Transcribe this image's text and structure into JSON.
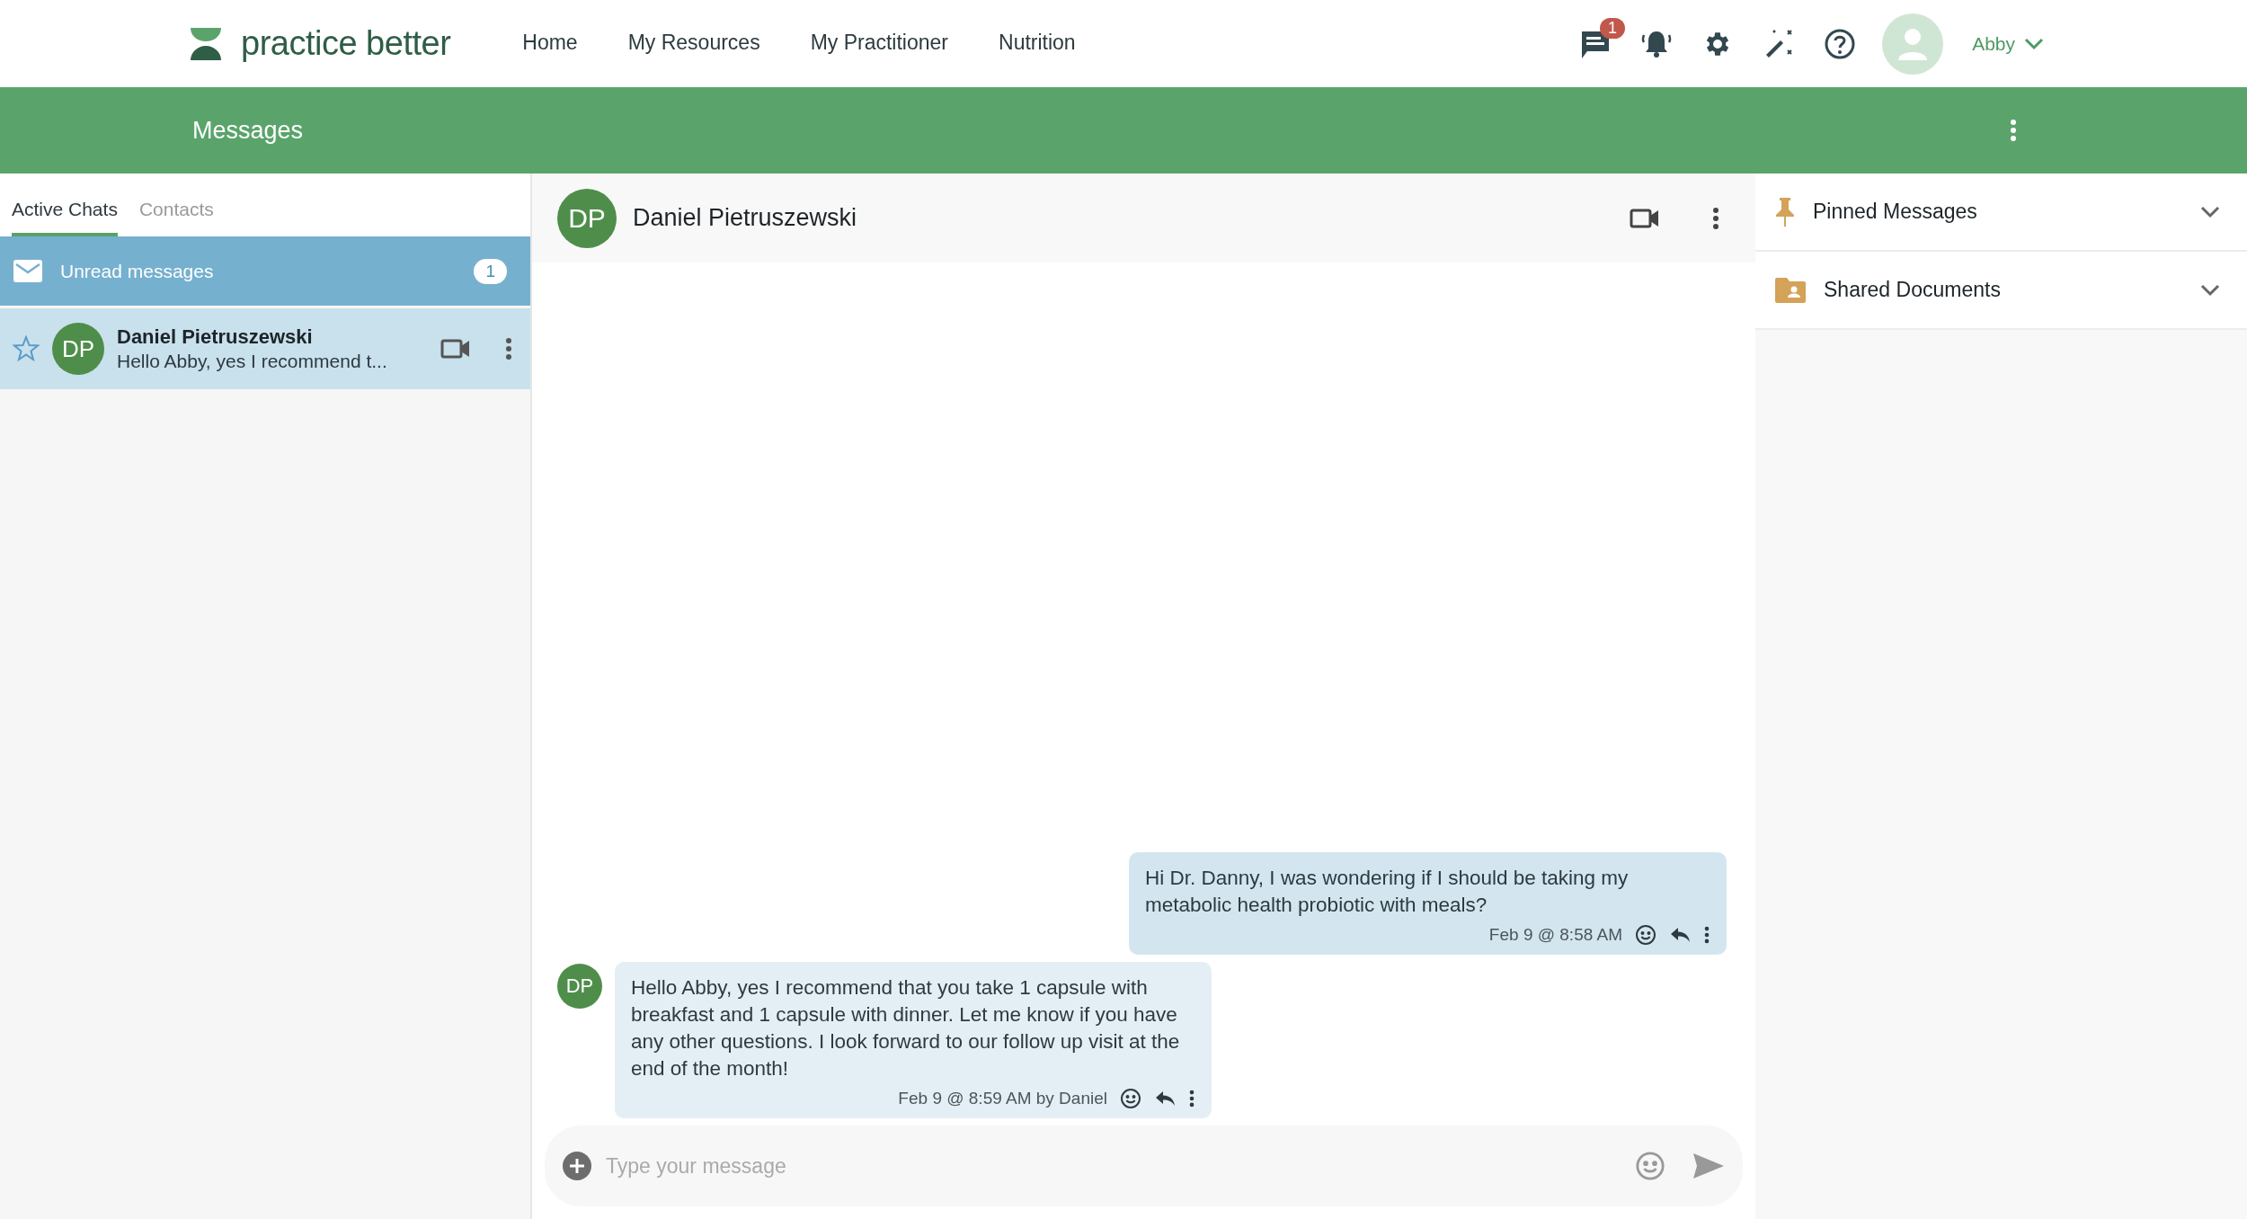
{
  "header": {
    "logo_text": "practice better",
    "nav": [
      {
        "label": "Home",
        "selected": false
      },
      {
        "label": "My Resources",
        "selected": false
      },
      {
        "label": "My Practitioner",
        "selected": false
      },
      {
        "label": "Nutrition",
        "selected": false
      }
    ],
    "messages_badge": "1",
    "user_name": "Abby"
  },
  "page_title": "Messages",
  "sidebar": {
    "tabs": [
      {
        "label": "Active Chats",
        "selected": true
      },
      {
        "label": "Contacts",
        "selected": false
      }
    ],
    "unread": {
      "label": "Unread messages",
      "count": "1"
    },
    "chats": [
      {
        "initials": "DP",
        "name": "Daniel Pietruszewski",
        "preview": "Hello Abby, yes I recommend t...",
        "starred": false,
        "selected": true
      }
    ]
  },
  "conversation": {
    "initials": "DP",
    "name": "Daniel Pietruszewski",
    "messages": [
      {
        "kind": "sent",
        "text": "Hi Dr. Danny, I was wondering if I should be taking my metabolic health probiotic with meals?",
        "meta": "Feb 9 @ 8:58 AM"
      },
      {
        "kind": "received",
        "initials": "DP",
        "text": "Hello Abby, yes I recommend that you take 1 capsule with breakfast and 1 capsule with dinner. Let me know if you have any other questions. I look forward to our follow up visit at the end of the month!",
        "meta": "Feb 9 @ 8:59 AM by Daniel"
      }
    ],
    "composer": {
      "placeholder": "Type your message"
    }
  },
  "side_panels": [
    {
      "kind": "pinned",
      "label": "Pinned Messages",
      "expanded": false
    },
    {
      "kind": "documents",
      "label": "Shared Documents",
      "expanded": false
    }
  ]
}
